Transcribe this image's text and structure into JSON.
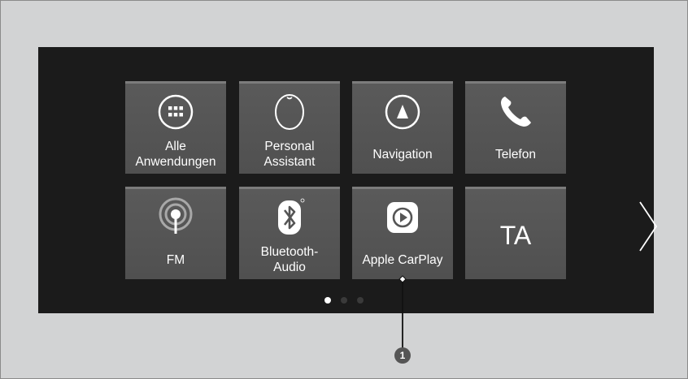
{
  "tiles": [
    {
      "label_line1": "Alle",
      "label_line2": "Anwendungen",
      "icon": "app-grid-icon"
    },
    {
      "label_line1": "Personal",
      "label_line2": "Assistant",
      "icon": "assistant-icon"
    },
    {
      "label": "Navigation",
      "icon": "navigation-icon"
    },
    {
      "label": "Telefon",
      "icon": "phone-icon"
    },
    {
      "label": "FM",
      "icon": "radio-icon"
    },
    {
      "label_line1": "Bluetooth-",
      "label_line2": "Audio",
      "icon": "bluetooth-icon"
    },
    {
      "label": "Apple CarPlay",
      "icon": "carplay-icon"
    },
    {
      "label": "TA"
    }
  ],
  "pager": {
    "count": 3,
    "active": 0
  },
  "next_page": {
    "icon": "chevron-right-icon"
  },
  "callout": {
    "number": "1"
  },
  "colors": {
    "frame_bg": "#d2d3d4",
    "screen_bg": "#1b1b1b",
    "tile_bg": "#555555",
    "tile_top_border": "#7c7c7c",
    "text": "#ffffff"
  }
}
